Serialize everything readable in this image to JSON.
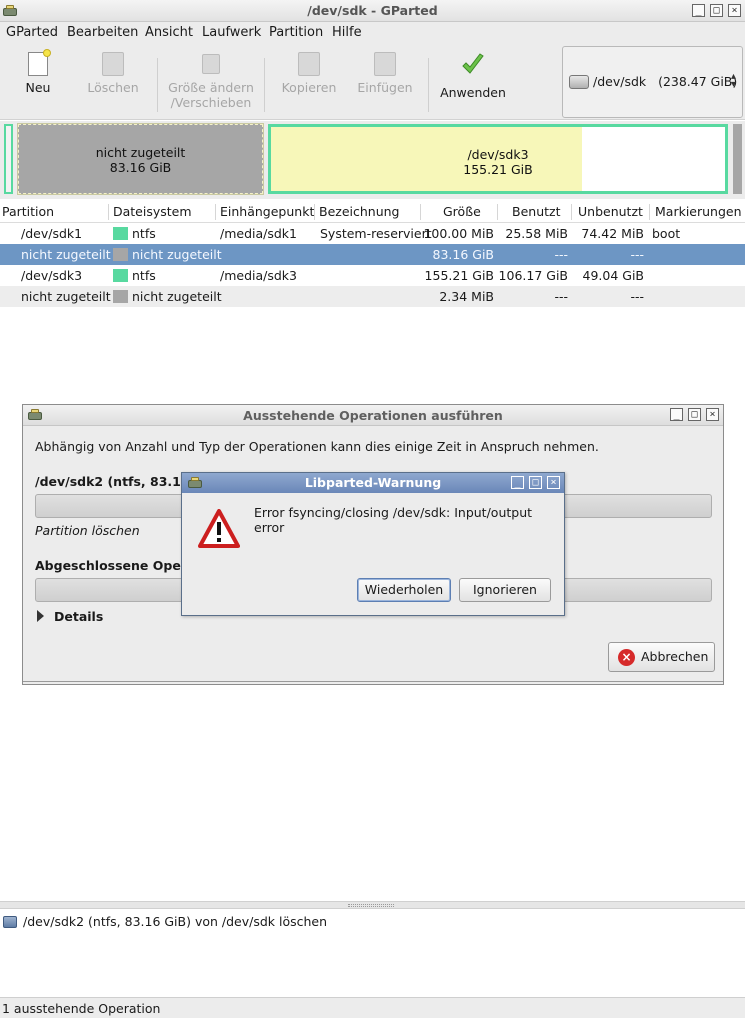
{
  "window": {
    "title": "/dev/sdk - GParted",
    "min": "_",
    "max": "□",
    "close": "×"
  },
  "menu": [
    "GParted",
    "Bearbeiten",
    "Ansicht",
    "Laufwerk",
    "Partition",
    "Hilfe"
  ],
  "toolbar": {
    "new": "Neu",
    "delete": "Löschen",
    "resize_1": "Größe ändern",
    "resize_2": "/Verschieben",
    "copy": "Kopieren",
    "paste": "Einfügen",
    "apply": "Anwenden"
  },
  "device": {
    "name": "/dev/sdk",
    "size": "(238.47 GiB)"
  },
  "map": {
    "unalloc_label": "nicht zugeteilt",
    "unalloc_size": "83.16 GiB",
    "sdk3_label": "/dev/sdk3",
    "sdk3_size": "155.21 GiB",
    "sdk3_used_fraction": 0.684,
    "colors": {
      "ntfs": "#58d9a0",
      "unallocated": "#a6a6a6",
      "used": "#f7f7b9",
      "selection": "#6d96c4"
    }
  },
  "table": {
    "headers": [
      "Partition",
      "Dateisystem",
      "Einhängepunkt",
      "Bezeichnung",
      "Größe",
      "Benutzt",
      "Unbenutzt",
      "Markierungen"
    ],
    "rows": [
      {
        "partition": "/dev/sdk1",
        "fs": "ntfs",
        "mount": "/media/sdk1",
        "label": "System-reserviert",
        "size": "100.00 MiB",
        "used": "25.58 MiB",
        "unused": "74.42 MiB",
        "flags": "boot"
      },
      {
        "partition": "nicht zugeteilt",
        "fs": "nicht zugeteilt",
        "mount": "",
        "label": "",
        "size": "83.16 GiB",
        "used": "---",
        "unused": "---",
        "flags": ""
      },
      {
        "partition": "/dev/sdk3",
        "fs": "ntfs",
        "mount": "/media/sdk3",
        "label": "",
        "size": "155.21 GiB",
        "used": "106.17 GiB",
        "unused": "49.04 GiB",
        "flags": ""
      },
      {
        "partition": "nicht zugeteilt",
        "fs": "nicht zugeteilt",
        "mount": "",
        "label": "",
        "size": "2.34 MiB",
        "used": "---",
        "unused": "---",
        "flags": ""
      }
    ]
  },
  "pending_dialog": {
    "title": "Ausstehende Operationen ausführen",
    "description": "Abhängig von Anzahl und Typ der Operationen kann dies einige Zeit in Anspruch nehmen.",
    "op_heading": "/dev/sdk2 (ntfs, 83.16 GiB) von /dev/sdk löschen",
    "op_heading_visible": "/dev/sdk2 (ntfs, 83.16 G",
    "op_action": "Partition löschen",
    "completed_heading": "Abgeschlossene Operat",
    "details": "Details",
    "cancel": "Abbrechen"
  },
  "warning_dialog": {
    "title": "Libparted-Warnung",
    "message": "Error fsyncing/closing /dev/sdk: Input/output error",
    "retry": "Wiederholen",
    "ignore": "Ignorieren"
  },
  "operations_list": [
    "/dev/sdk2 (ntfs, 83.16 GiB) von /dev/sdk löschen"
  ],
  "status": "1 ausstehende Operation"
}
